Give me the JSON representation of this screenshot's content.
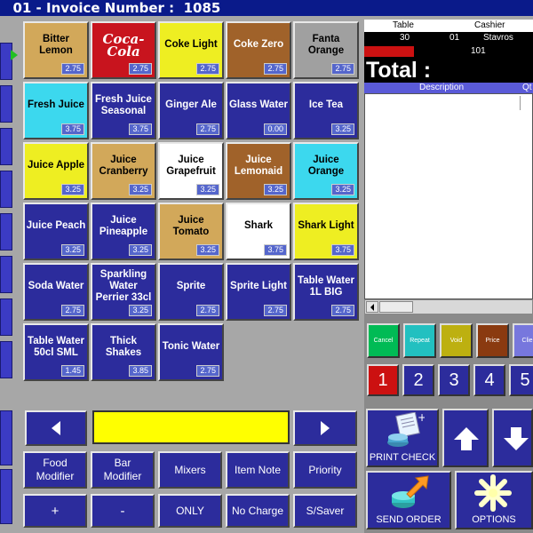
{
  "title": "  01 - Invoice Number :  1085",
  "products": [
    {
      "name": "Bitter Lemon",
      "price": "2.75",
      "color": "tan"
    },
    {
      "name": "Coca-Cola",
      "price": "2.75",
      "color": "red",
      "logo": true
    },
    {
      "name": "Coke Light",
      "price": "2.75",
      "color": "yellow"
    },
    {
      "name": "Coke Zero",
      "price": "2.75",
      "color": "brown"
    },
    {
      "name": "Fanta Orange",
      "price": "2.75",
      "color": "gray"
    },
    {
      "name": "Fresh Juice",
      "price": "3.75",
      "color": "cyan"
    },
    {
      "name": "Fresh Juice Seasonal",
      "price": "3.75",
      "color": "blue"
    },
    {
      "name": "Ginger Ale",
      "price": "2.75",
      "color": "blue"
    },
    {
      "name": "Glass Water",
      "price": "0.00",
      "color": "blue"
    },
    {
      "name": "Ice Tea",
      "price": "3.25",
      "color": "blue"
    },
    {
      "name": "Juice Apple",
      "price": "3.25",
      "color": "yellow"
    },
    {
      "name": "Juice Cranberry",
      "price": "3.25",
      "color": "tan"
    },
    {
      "name": "Juice Grapefruit",
      "price": "3.25",
      "color": "white"
    },
    {
      "name": "Juice Lemonaid",
      "price": "3.25",
      "color": "brown"
    },
    {
      "name": "Juice Orange",
      "price": "3.25",
      "color": "cyan"
    },
    {
      "name": "Juice Peach",
      "price": "3.25",
      "color": "blue"
    },
    {
      "name": "Juice Pineapple",
      "price": "3.25",
      "color": "blue"
    },
    {
      "name": "Juice Tomato",
      "price": "3.25",
      "color": "tan"
    },
    {
      "name": "Shark",
      "price": "3.75",
      "color": "white"
    },
    {
      "name": "Shark Light",
      "price": "3.75",
      "color": "yellow"
    },
    {
      "name": "Soda Water",
      "price": "2.75",
      "color": "blue"
    },
    {
      "name": "Sparkling Water Perrier 33cl",
      "price": "3.25",
      "color": "blue"
    },
    {
      "name": "Sprite",
      "price": "2.75",
      "color": "blue"
    },
    {
      "name": "Sprite Light",
      "price": "2.75",
      "color": "blue"
    },
    {
      "name": "Table Water 1L BIG",
      "price": "2.75",
      "color": "blue"
    },
    {
      "name": "Table Water 50cl SML",
      "price": "1.45",
      "color": "blue"
    },
    {
      "name": "Thick Shakes",
      "price": "3.85",
      "color": "blue"
    },
    {
      "name": "Tonic Water",
      "price": "2.75",
      "color": "blue"
    }
  ],
  "controls": {
    "prev_icon": "arrow-left-icon",
    "next_icon": "arrow-right-icon",
    "entry_value": "",
    "food_modifier": "Food\nModifier",
    "bar_modifier": "Bar\nModifier",
    "mixers": "Mixers",
    "item_note": "Item Note",
    "priority": "Priority",
    "plus": "+",
    "minus": "-",
    "only": "ONLY",
    "no_charge": "No Charge",
    "s_saver": "S/Saver"
  },
  "order": {
    "table_label": "Table",
    "cashier_label": "Cashier",
    "table": "30",
    "seat": "01",
    "cashier": "Stavros",
    "check": "101",
    "total_label": "Total :",
    "desc_label": "Description",
    "qty_label": "Qt"
  },
  "functions": [
    {
      "label": "Cancel",
      "color": "#00bb55"
    },
    {
      "label": "Repeat",
      "color": "#22c0c0"
    },
    {
      "label": "Void",
      "color": "#bdb010"
    },
    {
      "label": "Price",
      "color": "#8a3a10"
    },
    {
      "label": "Clien",
      "color": "#7777dd"
    }
  ],
  "numbers": [
    "1",
    "2",
    "3",
    "4",
    "5"
  ],
  "actions": {
    "print_check": "PRINT CHECK",
    "send_order": "SEND ORDER",
    "options": "OPTIONS",
    "up_icon": "arrow-up-icon",
    "down_icon": "arrow-down-icon"
  }
}
